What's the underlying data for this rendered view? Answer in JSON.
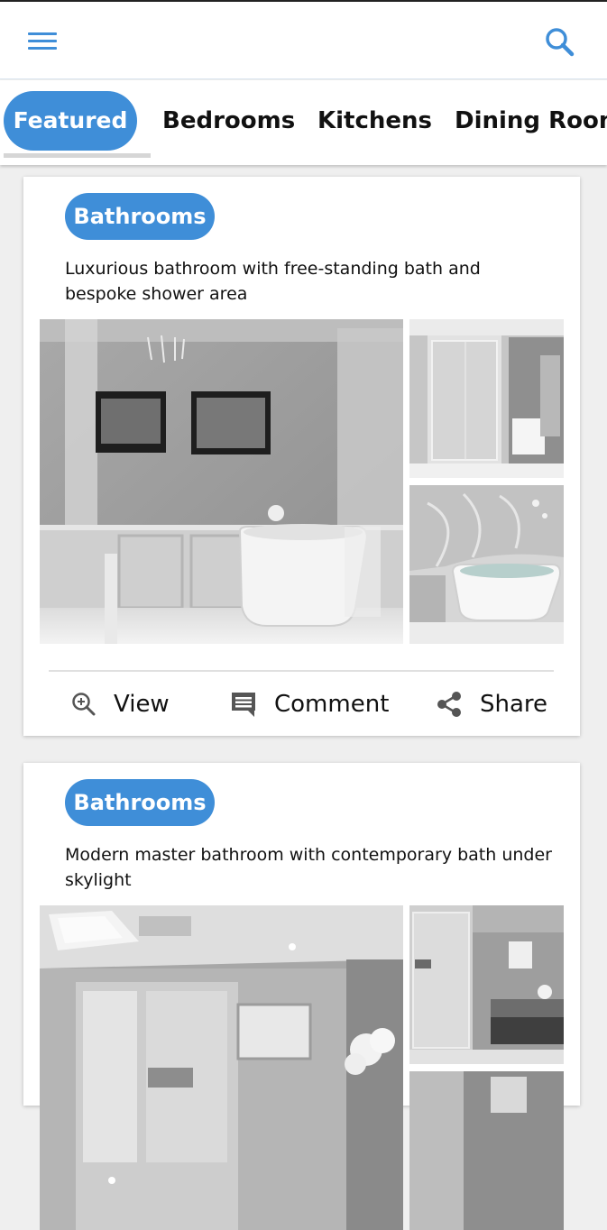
{
  "appbar": {
    "menu_icon": "hamburger-menu-icon",
    "search_icon": "search-icon",
    "accent_color": "#3f8ed8"
  },
  "tabs": [
    {
      "label": "Featured",
      "active": true
    },
    {
      "label": "Bedrooms",
      "active": false
    },
    {
      "label": "Kitchens",
      "active": false
    },
    {
      "label": "Dining Rooms",
      "active": false
    }
  ],
  "cards": [
    {
      "category": "Bathrooms",
      "description": "Luxurious bathroom with free-standing bath and bespoke shower area",
      "images": [
        "bathroom-main-photo",
        "shower-photo",
        "freestanding-bath-photo"
      ],
      "actions": {
        "view": "View",
        "comment": "Comment",
        "share": "Share"
      },
      "action_icons": {
        "view": "zoom-in-icon",
        "comment": "comment-icon",
        "share": "share-icon"
      }
    },
    {
      "category": "Bathrooms",
      "description": "Modern master bathroom with contemporary bath under skylight",
      "images": [
        "skylight-bathroom-photo",
        "glass-shower-photo",
        "vanity-photo"
      ]
    }
  ]
}
